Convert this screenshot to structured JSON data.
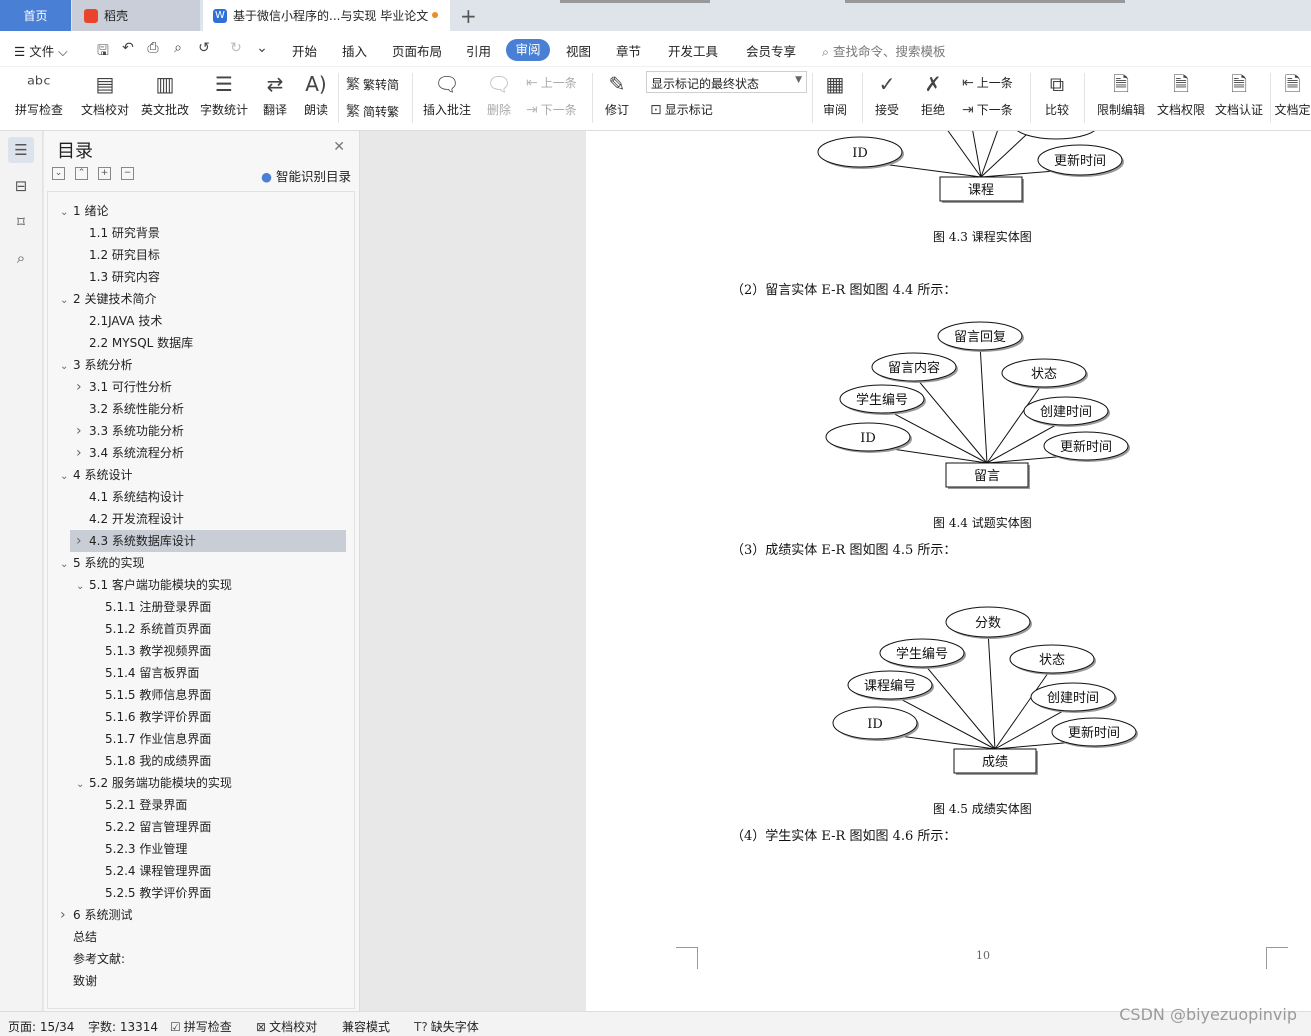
{
  "tabs": {
    "home": "首页",
    "wk": "稻壳",
    "doc": "基于微信小程序的...与实现 毕业论文"
  },
  "menu": {
    "file": "文件",
    "items": [
      "开始",
      "插入",
      "页面布局",
      "引用",
      "审阅",
      "视图",
      "章节",
      "开发工具",
      "会员专享"
    ],
    "active": "审阅",
    "search": "查找命令、搜索模板"
  },
  "ribbon": {
    "spell": "拼写检查",
    "doc_proof": "文档校对",
    "en_review": "英文批改",
    "wordcount": "字数统计",
    "translate": "翻译",
    "read": "朗读",
    "to_trad": "繁转简",
    "to_simp": "简转繁",
    "insert_comment": "插入批注",
    "delete": "删除",
    "prev": "上一条",
    "next": "下一条",
    "track": "修订",
    "markup_select": "显示标记的最终状态",
    "show_markup": "显示标记",
    "review": "审阅",
    "accept": "接受",
    "reject": "拒绝",
    "prev2": "上一条",
    "next2": "下一条",
    "compare": "比较",
    "restrict": "限制编辑",
    "perm": "文档权限",
    "auth": "文档认证",
    "finalize": "文档定"
  },
  "toc": {
    "title": "目录",
    "smart": "智能识别目录",
    "items": [
      {
        "label": "1  绪论",
        "level": 0,
        "chev": "v"
      },
      {
        "label": "1.1 研究背景",
        "level": 1,
        "chev": ""
      },
      {
        "label": "1.2 研究目标",
        "level": 1,
        "chev": ""
      },
      {
        "label": "1.3 研究内容",
        "level": 1,
        "chev": ""
      },
      {
        "label": "2  关键技术简介",
        "level": 0,
        "chev": "v"
      },
      {
        "label": "2.1JAVA 技术",
        "level": 1,
        "chev": ""
      },
      {
        "label": "2.2 MYSQL 数据库",
        "level": 1,
        "chev": ""
      },
      {
        "label": "3  系统分析",
        "level": 0,
        "chev": "v"
      },
      {
        "label": "3.1 可行性分析",
        "level": 1,
        "chev": ">"
      },
      {
        "label": "3.2 系统性能分析",
        "level": 1,
        "chev": ""
      },
      {
        "label": "3.3 系统功能分析",
        "level": 1,
        "chev": ">"
      },
      {
        "label": "3.4 系统流程分析",
        "level": 1,
        "chev": ">"
      },
      {
        "label": "4  系统设计",
        "level": 0,
        "chev": "v"
      },
      {
        "label": "4.1 系统结构设计",
        "level": 1,
        "chev": ""
      },
      {
        "label": "4.2 开发流程设计",
        "level": 1,
        "chev": ""
      },
      {
        "label": "4.3 系统数据库设计",
        "level": 1,
        "chev": ">",
        "selected": true
      },
      {
        "label": "5  系统的实现",
        "level": 0,
        "chev": "v"
      },
      {
        "label": "5.1 客户端功能模块的实现",
        "level": 1,
        "chev": "v"
      },
      {
        "label": "5.1.1 注册登录界面",
        "level": 2,
        "chev": ""
      },
      {
        "label": "5.1.2 系统首页界面",
        "level": 2,
        "chev": ""
      },
      {
        "label": "5.1.3 教学视频界面",
        "level": 2,
        "chev": ""
      },
      {
        "label": "5.1.4 留言板界面",
        "level": 2,
        "chev": ""
      },
      {
        "label": "5.1.5 教师信息界面",
        "level": 2,
        "chev": ""
      },
      {
        "label": "5.1.6 教学评价界面",
        "level": 2,
        "chev": ""
      },
      {
        "label": "5.1.7 作业信息界面",
        "level": 2,
        "chev": ""
      },
      {
        "label": "5.1.8 我的成绩界面",
        "level": 2,
        "chev": ""
      },
      {
        "label": "5.2 服务端功能模块的实现",
        "level": 1,
        "chev": "v"
      },
      {
        "label": "5.2.1 登录界面",
        "level": 2,
        "chev": ""
      },
      {
        "label": "5.2.2 留言管理界面",
        "level": 2,
        "chev": ""
      },
      {
        "label": "5.2.3 作业管理",
        "level": 2,
        "chev": ""
      },
      {
        "label": "5.2.4 课程管理界面",
        "level": 2,
        "chev": ""
      },
      {
        "label": "5.2.5 教学评价界面",
        "level": 2,
        "chev": ""
      },
      {
        "label": "6  系统测试",
        "level": 0,
        "chev": ">"
      },
      {
        "label": "总结",
        "level": 0,
        "chev": ""
      },
      {
        "label": "参考文献:",
        "level": 0,
        "chev": ""
      },
      {
        "label": "致谢",
        "level": 0,
        "chev": ""
      }
    ]
  },
  "doc": {
    "er1": {
      "entity": "课程",
      "attrs": [
        "ID",
        "更新时间"
      ],
      "caption": "图 4.3  课程实体图"
    },
    "para2": "（2）留言实体 E-R 图如图 4.4 所示：",
    "er2": {
      "entity": "留言",
      "attrs": [
        "ID",
        "学生编号",
        "留言内容",
        "留言回复",
        "状态",
        "创建时间",
        "更新时间"
      ],
      "caption": "图 4.4  试题实体图"
    },
    "para3": "（3）成绩实体 E-R 图如图 4.5 所示：",
    "er3": {
      "entity": "成绩",
      "attrs": [
        "ID",
        "课程编号",
        "学生编号",
        "分数",
        "状态",
        "创建时间",
        "更新时间"
      ],
      "caption": "图 4.5  成绩实体图"
    },
    "para4": "（4）学生实体 E-R 图如图 4.6 所示：",
    "page_number": "10"
  },
  "status": {
    "page": "页面: 15/34",
    "words": "字数: 13314",
    "spell": "拼写检查",
    "proof": "文档校对",
    "compat": "兼容模式",
    "missing_font": "缺失字体"
  },
  "watermark": "CSDN @biyezuopinvip"
}
